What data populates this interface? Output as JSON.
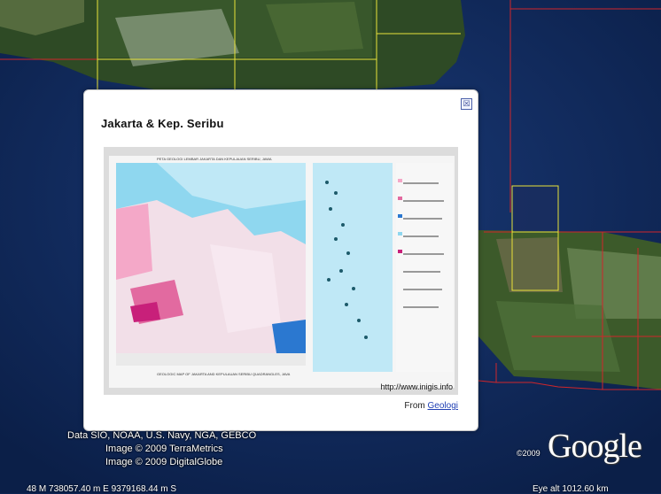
{
  "popup": {
    "title": "Jakarta & Kep. Seribu",
    "close_glyph": "☒",
    "image_url_text": "http://www.inigis.info",
    "from_label": "From",
    "from_link": "Geologi",
    "map_heading": "PETA GEOLOGI LEMBAR JAKARTA DAN KEPULAUAN SERIBU, JAWA",
    "map_subheading": "GEOLOGIC MAP OF JAKARTA AND KEPULAUAN SERIBU QUADRANGLES, JAVA"
  },
  "attribution": {
    "line1": "Data SIO, NOAA, U.S. Navy, NGA, GEBCO",
    "line2": "Image © 2009 TerraMetrics",
    "line3": "Image © 2009 DigitalGlobe"
  },
  "status": {
    "coords": "48 M 738057.40 m E 9379168.44 m S",
    "eye_alt": "Eye alt  1012.60 km"
  },
  "branding": {
    "copyright_year": "©2009",
    "logo_text": "Google"
  },
  "colors": {
    "ocean": "#0d2452",
    "grid_red": "#d0262b",
    "grid_yellow": "#e8e23a",
    "link": "#1f3fb4"
  }
}
